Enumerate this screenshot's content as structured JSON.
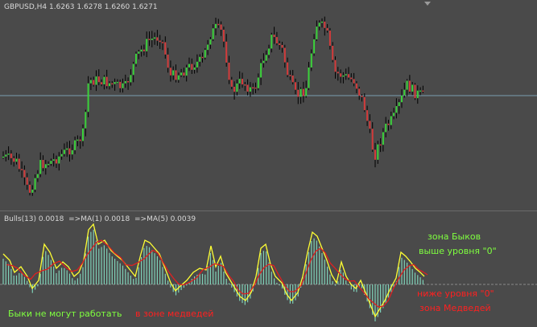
{
  "main_chart": {
    "symbol_label": "GBPUSD,H4",
    "ohlc": "1.6263 1.6278 1.6260 1.6271",
    "colors": {
      "bull": "#3bd13b",
      "bear": "#d33b3b",
      "wick": "#000000",
      "hline": "#7a9fb0"
    },
    "hline_level": 1.6252
  },
  "indicator": {
    "title": "Bulls(13) 0.0018",
    "ma1": "=>MA(1) 0.0018",
    "ma5": "=>MA(5) 0.0039",
    "colors": {
      "hist": "#7fd1b8",
      "ma1": "#ffff33",
      "ma5": "#e02020"
    }
  },
  "annotations": {
    "bull_zone_title": "зона Быков",
    "bull_zone_sub": "выше уровня \"0\"",
    "bulls_cannot_work": "Быки не могут работать",
    "in_bear_zone": "в зоне медведей",
    "below_zero": "ниже уровня \"0\"",
    "bear_zone": "зона Медведей",
    "colors": {
      "green": "#7fff3f",
      "red": "#ff2020"
    }
  }
}
